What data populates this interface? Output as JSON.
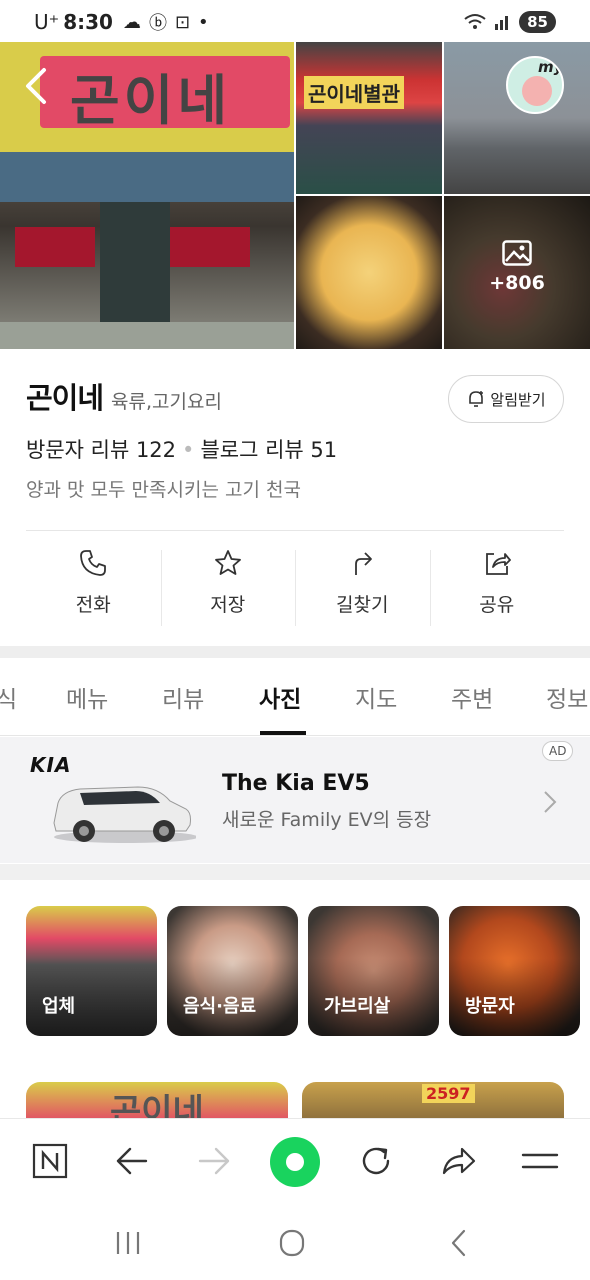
{
  "status_bar": {
    "carrier": "U⁺",
    "time": "8:30",
    "battery": "85"
  },
  "photos": {
    "main_sign_text": "곤이네",
    "thumb_sign_text": "곤이네별관",
    "more_count": "+806",
    "my_label": "my"
  },
  "place": {
    "name": "곤이네",
    "category": "육류,고기요리",
    "alarm_label": "알림받기",
    "visitor_reviews": "방문자 리뷰 122",
    "blog_reviews": "블로그 리뷰 51",
    "description": "양과 맛 모두 만족시키는 고기 천국"
  },
  "actions": [
    {
      "label": "전화",
      "icon": "phone-icon"
    },
    {
      "label": "저장",
      "icon": "star-icon"
    },
    {
      "label": "길찾기",
      "icon": "directions-icon"
    },
    {
      "label": "공유",
      "icon": "share-icon"
    }
  ],
  "tabs": [
    {
      "label": "식"
    },
    {
      "label": "메뉴"
    },
    {
      "label": "리뷰"
    },
    {
      "label": "사진",
      "active": true
    },
    {
      "label": "지도"
    },
    {
      "label": "주변"
    },
    {
      "label": "정보"
    }
  ],
  "ad": {
    "brand": "KIA",
    "title": "The Kia EV5",
    "subtitle": "새로운 Family EV의 등장",
    "badge": "AD"
  },
  "photo_categories": [
    {
      "label": "업체"
    },
    {
      "label": "음식·음료"
    },
    {
      "label": "가브리살"
    },
    {
      "label": "방문자"
    }
  ],
  "lower_photos": {
    "sign_text": "곤이네",
    "number_text": "2597"
  },
  "colors": {
    "accent_green": "#19d35e",
    "sign_red": "#e24a66",
    "sign_yellow": "#d9cc4a"
  }
}
